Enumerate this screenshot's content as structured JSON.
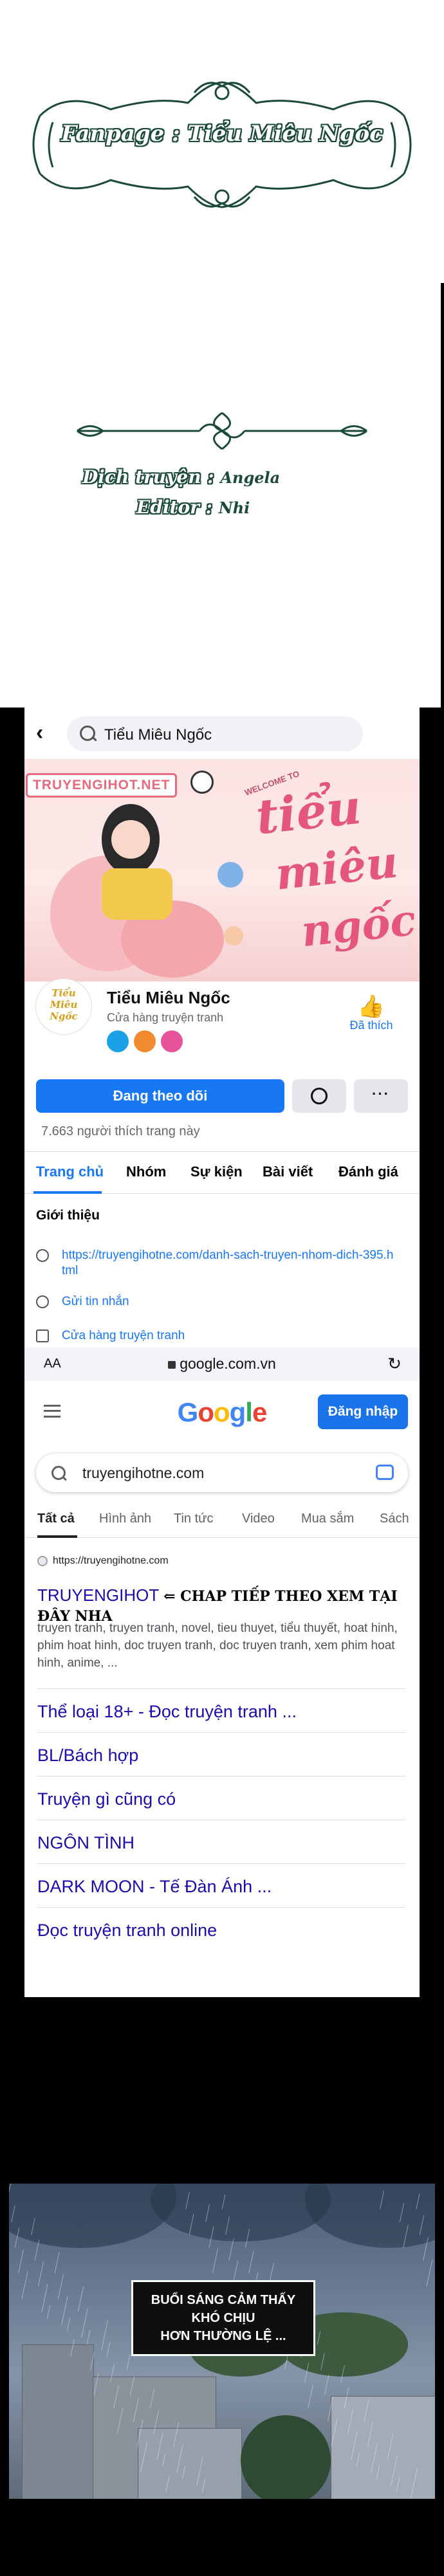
{
  "credits": {
    "fanpage": "Fanpage : Tiểu Miêu Ngốc",
    "translate_label": "Dịch truyện :",
    "translate_value": "Angela",
    "editor_label": "Editor :",
    "editor_value": "Nhi"
  },
  "facebook": {
    "search_text": "Tiểu Miêu Ngốc",
    "cover_brand": "TRUYENGIHOT.NET",
    "cover_welcome": "WELCOME TO",
    "cover_script": [
      "tiểu",
      "miêu",
      "ngốc"
    ],
    "avatar_text": "Tiểu Miêu Ngốc",
    "page_name": "Tiểu Miêu Ngốc",
    "page_category": "Cửa hàng truyện tranh",
    "liked_label": "Đã thích",
    "follow_label": "Đang theo dõi",
    "more_label": "···",
    "likes_text": "7.663 người thích trang này",
    "tabs": [
      "Trang chủ",
      "Nhóm",
      "Sự kiện",
      "Bài viết",
      "Đánh giá"
    ],
    "intro_title": "Giới thiệu",
    "intro_link": "https://truyengihotne.com/danh-sach-truyen-nhom-dich-395.html",
    "intro_message": "Gửi tin nhắn",
    "intro_shop": "Cửa hàng truyện tranh"
  },
  "safari": {
    "aa": "AA",
    "url": "google.com.vn",
    "reload": "↻"
  },
  "google": {
    "logo_letters": [
      "G",
      "o",
      "o",
      "g",
      "l",
      "e"
    ],
    "login_label": "Đăng nhập",
    "query": "truyengihotne.com",
    "tabs": [
      "Tất cả",
      "Hình ảnh",
      "Tin tức",
      "Video",
      "Mua sắm",
      "Sách"
    ],
    "site_url": "https://truyengihotne.com",
    "result_title": "TRUYENGIHOT",
    "result_title_hand": "⇐ CHAP TIẾP THEO XEM TẠI ĐÂY NHA",
    "result_snippet": "truyen tranh, truyen tranh, novel, tieu thuyet, tiểu thuyết, hoat hinh, phim hoat hinh, doc truyen tranh, doc truyen tranh, xem phim hoat hinh, anime, ...",
    "sitelinks": [
      "Thể loại 18+ - Đọc truyện tranh ...",
      "BL/Bách hợp",
      "Truyện gì cũng có",
      "NGÔN TÌNH",
      "DARK MOON - Tế Đàn Ánh ...",
      "Đọc truyện tranh online"
    ]
  },
  "comic": {
    "speech": [
      "BUỔI SÁNG CẢM THẤY KHÓ CHỊU",
      "HƠN THƯỜNG LỆ ..."
    ]
  },
  "colors": {
    "fb_blue": "#1877f2",
    "google_blue": "#4285f4",
    "google_red": "#ea4335",
    "google_yellow": "#fbbc05",
    "google_green": "#34a853",
    "ornament_green": "#1b4a38"
  },
  "icons": [
    "back-arrow-icon",
    "search-icon",
    "thumbs-up-icon",
    "messenger-icon",
    "globe-icon",
    "lock-icon",
    "reload-icon",
    "menu-icon",
    "camera-icon"
  ]
}
